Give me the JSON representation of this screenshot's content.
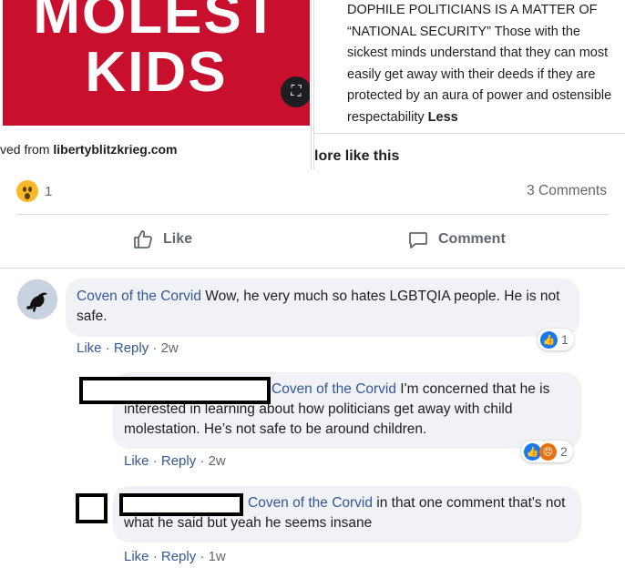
{
  "preview_left": {
    "poster_line1": "MOLEST",
    "poster_line2": "KIDS",
    "source_prefix": "ved from ",
    "source_domain": "libertyblitzkrieg.com",
    "expand_icon": "expand-icon"
  },
  "preview_right": {
    "excerpt": "DOPHILE POLITICIANS IS A MATTER OF “NATIONAL SECURITY” Those with the sickest minds understand that they can most easily get away with their deeds if they are protected by an aura of power and ostensible respectability",
    "less_link": "Less",
    "more_heading": "lore like this"
  },
  "reactions": {
    "icon": "wow-emoji-icon",
    "count": "1",
    "comments_count": "3 Comments"
  },
  "actions": {
    "like_label": "Like",
    "comment_label": "Comment"
  },
  "comments": [
    {
      "author": "Coven of the Corvid",
      "text": " Wow, he very much so hates LGBTQIA people. He is not safe.",
      "like": "Like",
      "reply": "Reply",
      "time": "2w",
      "reaction_count": "1"
    },
    {
      "author": "Coven of the Corvid",
      "text": " I'm concerned that he is interested in learning about how politicians get away with child molestation. He’s not safe to be around children.",
      "like": "Like",
      "reply": "Reply",
      "time": "2w",
      "reaction_count": "2"
    },
    {
      "author": "Coven of the Corvid",
      "text": " in that one comment that's not what he said but yeah he seems insane",
      "like": "Like",
      "reply": "Reply",
      "time": "1w"
    }
  ],
  "separator": " · ",
  "colors": {
    "poster_red": "#c8102e",
    "link_blue": "#365899",
    "bubble_gray": "#f0f2f5",
    "like_blue": "#1877f2",
    "angry_orange": "#e9710f"
  }
}
